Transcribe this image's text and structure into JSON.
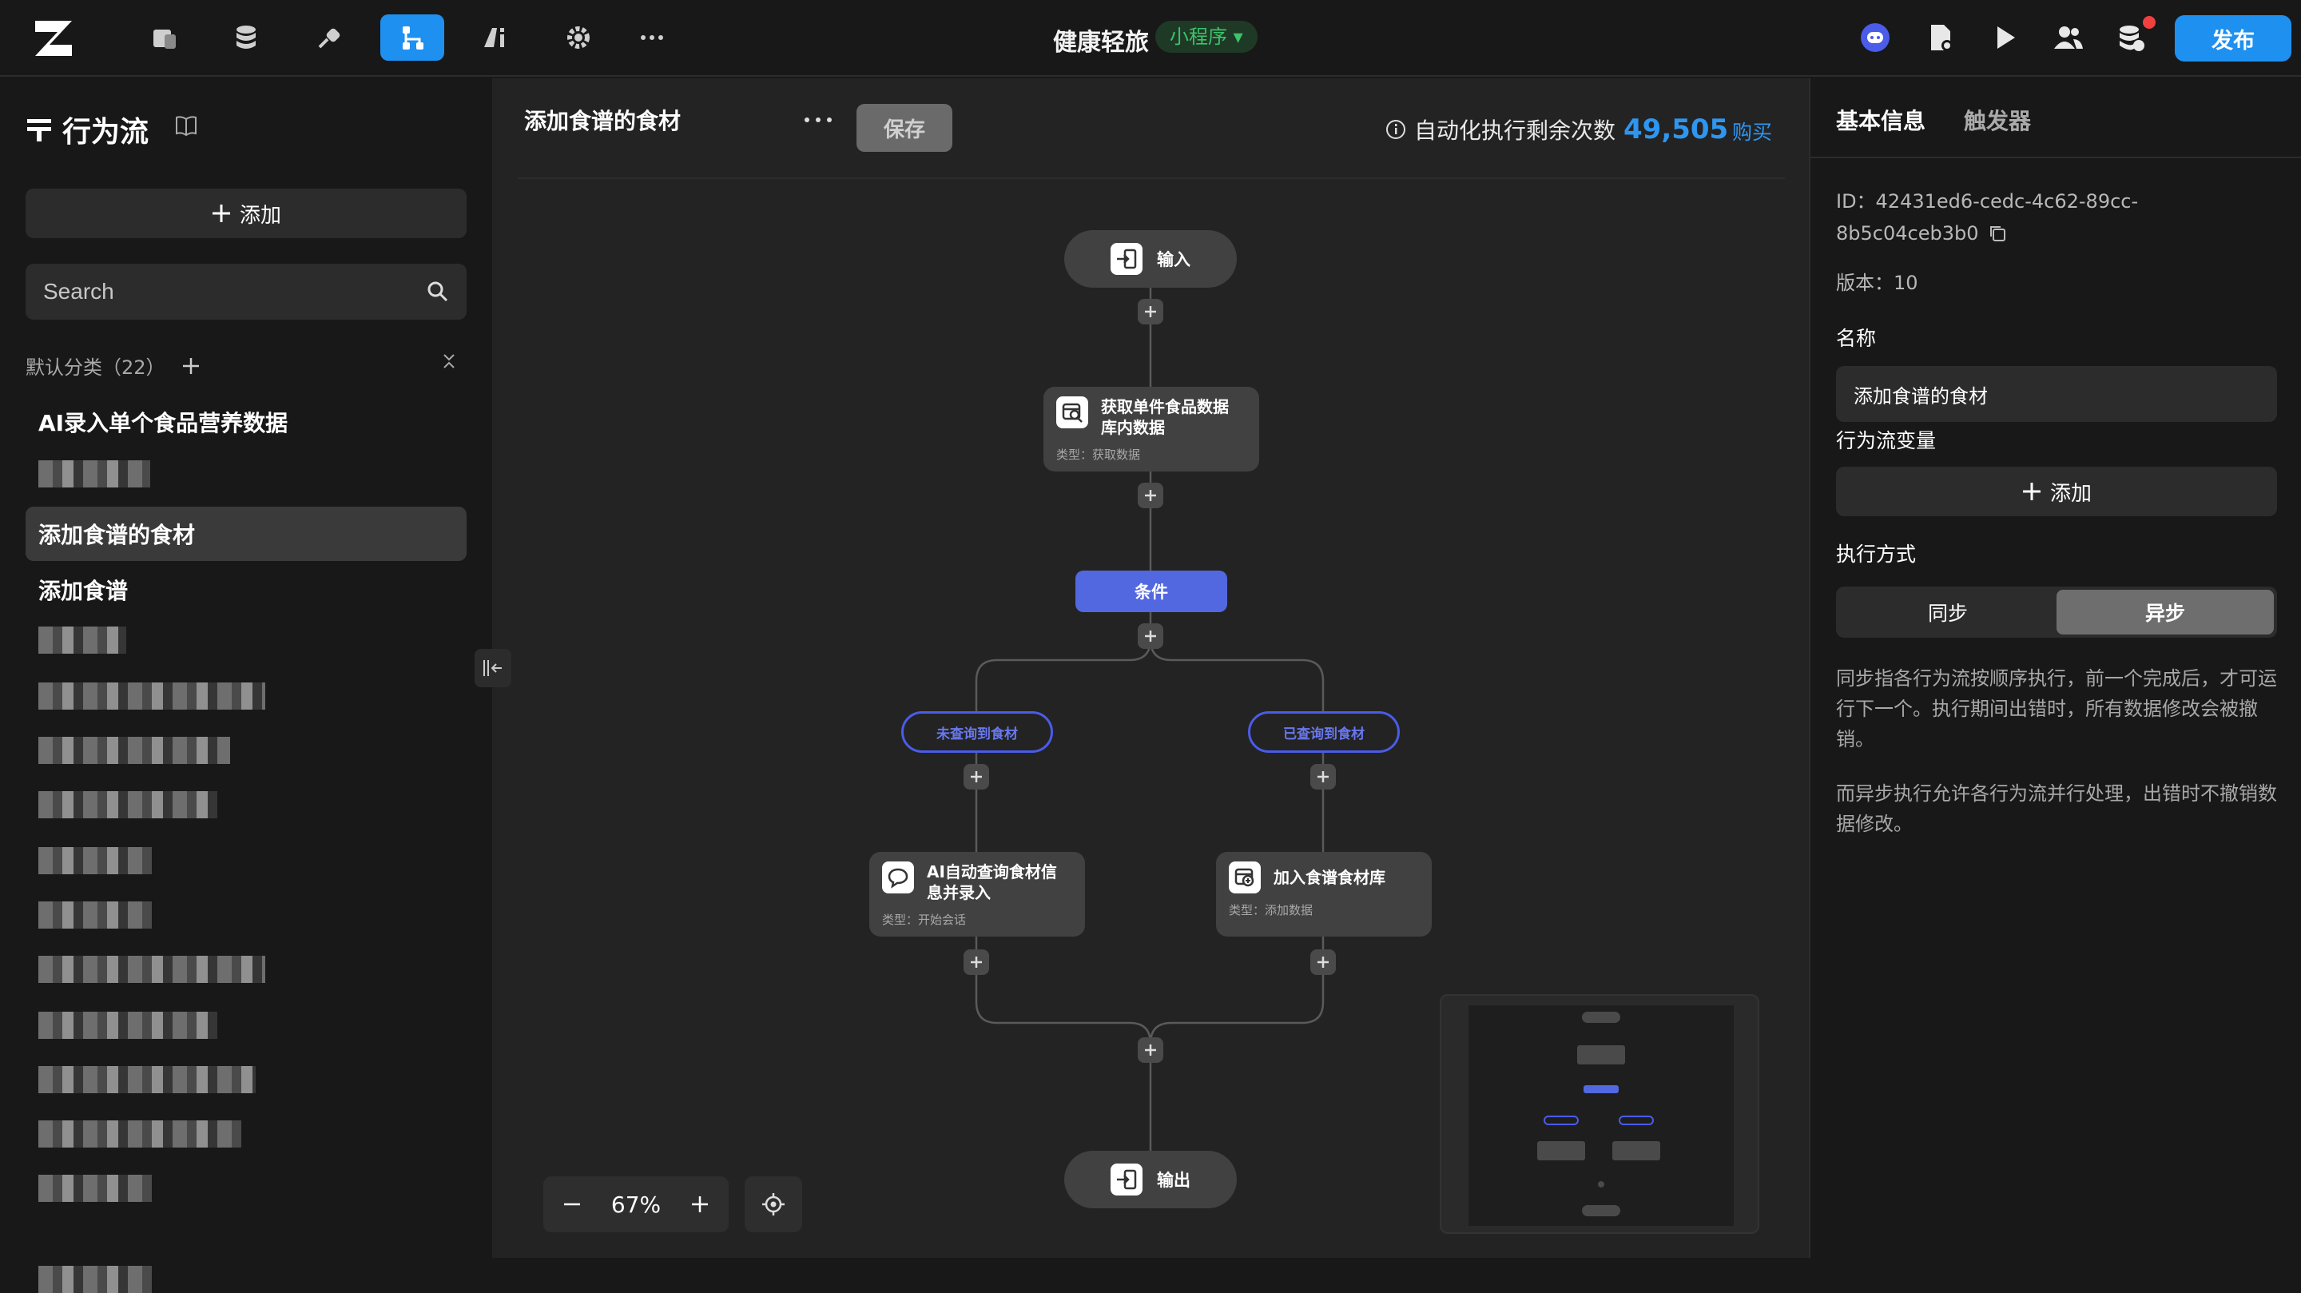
{
  "topbar": {
    "app_title": "健康轻旅",
    "app_badge": "小程序",
    "publish_label": "发布",
    "nav_icons": [
      "pages-icon",
      "database-icon",
      "plugin-icon",
      "flow-icon",
      "ai-icon",
      "settings-icon",
      "more-icon"
    ],
    "active_nav": "flow-icon",
    "accent": "#1e90f0"
  },
  "sidebar": {
    "title": "行为流",
    "add_label": "添加",
    "search_placeholder": "Search",
    "category_label": "默认分类（22）",
    "items": [
      {
        "label": "AI录入单个食品营养数据"
      },
      {
        "label": "添加食谱的食材"
      },
      {
        "label": "添加食谱"
      }
    ],
    "active_item": "添加食谱的食材"
  },
  "canvas": {
    "flow_title": "添加食谱的食材",
    "more_label": "···",
    "save_label": "保存",
    "quota_label": "自动化执行剩余次数",
    "quota_value": "49,505",
    "buy_label": "购买",
    "zoom": "67%",
    "nodes": {
      "input": "输入",
      "fetch_title": "获取单件食品数据库内数据",
      "fetch_type": "类型：获取数据",
      "condition": "条件",
      "branch_left": "未查询到食材",
      "branch_right": "已查询到食材",
      "ai_title": "AI自动查询食材信息并录入",
      "ai_type": "类型：开始会话",
      "add_title": "加入食谱食材库",
      "add_type": "类型：添加数据",
      "output": "输出"
    }
  },
  "right_panel": {
    "tab_basic": "基本信息",
    "tab_trigger": "触发器",
    "id_label": "ID：42431ed6-cedc-4c62-89cc-",
    "id_label_2": "8b5c04ceb3b0",
    "version": "版本：10",
    "name_label": "名称",
    "name_value": "添加食谱的食材",
    "vars_label": "行为流变量",
    "vars_add": "添加",
    "exec_label": "执行方式",
    "exec_sync": "同步",
    "exec_async": "异步",
    "desc_sync": "同步指各行为流按顺序执行，前一个完成后，才可运行下一个。执行期间出错时，所有数据修改会被撤销。",
    "desc_async": "而异步执行允许各行为流并行处理，出错时不撤销数据修改。"
  }
}
